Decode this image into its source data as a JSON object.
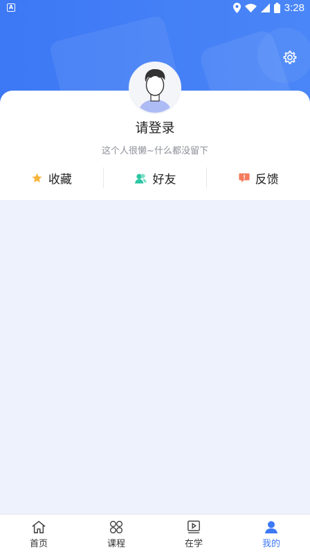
{
  "status_bar": {
    "time": "3:28"
  },
  "profile": {
    "login_prompt": "请登录",
    "bio": "这个人很懒~什么都没留下"
  },
  "actions": [
    {
      "label": "收藏",
      "icon": "star-icon",
      "color": "#f7b53b"
    },
    {
      "label": "好友",
      "icon": "friends-icon",
      "color": "#2cc6a3"
    },
    {
      "label": "反馈",
      "icon": "feedback-icon",
      "color": "#f47b5c"
    }
  ],
  "tabs": [
    {
      "label": "首页",
      "icon": "home-icon",
      "active": false
    },
    {
      "label": "课程",
      "icon": "courses-icon",
      "active": false
    },
    {
      "label": "在学",
      "icon": "learning-icon",
      "active": false
    },
    {
      "label": "我的",
      "icon": "profile-icon",
      "active": true
    }
  ],
  "colors": {
    "header_blue": "#3d78f5",
    "active_tab": "#3d78f5",
    "page_background": "#eef2fc"
  }
}
